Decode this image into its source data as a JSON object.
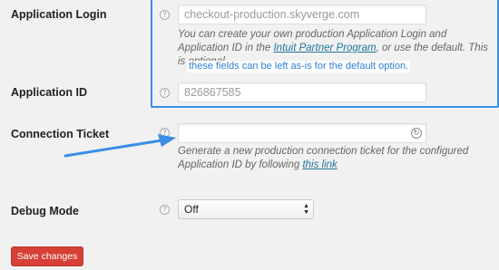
{
  "fields": {
    "app_login": {
      "label": "Application Login",
      "value": "checkout-production.skyverge.com",
      "help": "?"
    },
    "app_login_desc": {
      "part1": "You can create your own production Application Login and Application ID in the ",
      "link": "Intuit Partner Program",
      "part2": ", or use the default. This is optional."
    },
    "annotation": "these fields can be left as-is for the default option.",
    "app_id": {
      "label": "Application ID",
      "value": "826867585",
      "help": "?"
    },
    "connection_ticket": {
      "label": "Connection Ticket",
      "value": "",
      "help": "?"
    },
    "connection_ticket_desc": {
      "part1": "Generate a new production connection ticket for the configured Application ID by following ",
      "link": "this link"
    },
    "debug_mode": {
      "label": "Debug Mode",
      "selected": "Off",
      "help": "?"
    }
  },
  "buttons": {
    "save": "Save changes"
  },
  "colors": {
    "background": "#f1f1f1",
    "highlight": "#3b8ee6",
    "link": "#21759b",
    "save_button": "#d64036"
  }
}
